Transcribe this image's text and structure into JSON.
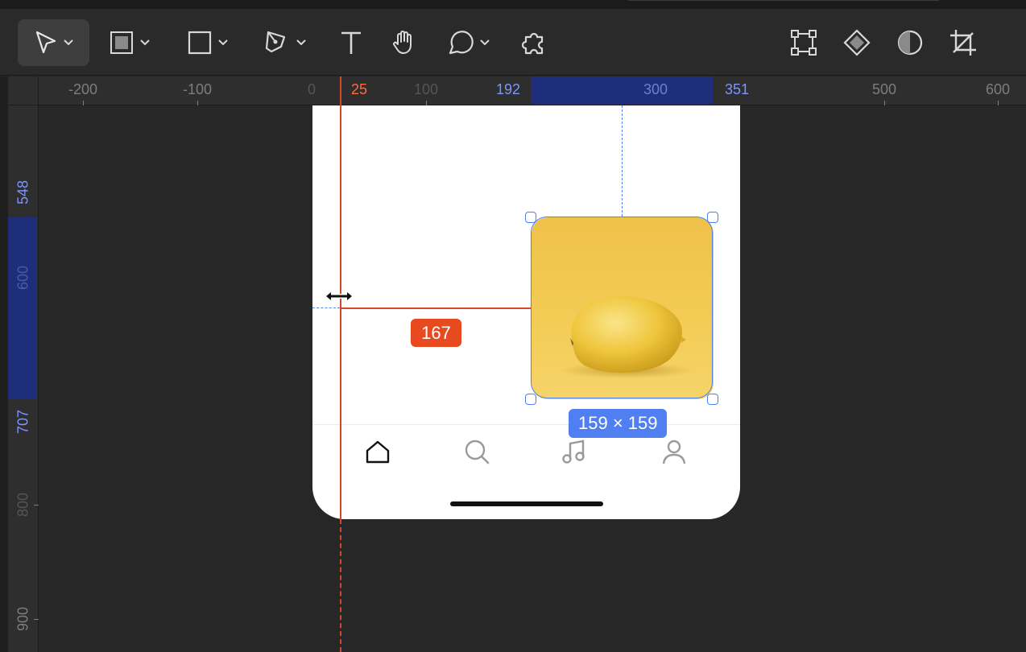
{
  "toolbar": {
    "tools": [
      {
        "name": "move-tool",
        "icon": "cursor-arrow-icon",
        "has_dropdown": true,
        "active": true
      },
      {
        "name": "frame-tool",
        "icon": "frame-icon",
        "has_dropdown": true
      },
      {
        "name": "rectangle-tool",
        "icon": "rectangle-icon",
        "has_dropdown": true
      },
      {
        "name": "pen-tool",
        "icon": "pen-icon",
        "has_dropdown": true
      },
      {
        "name": "text-tool",
        "icon": "text-icon"
      },
      {
        "name": "hand-tool",
        "icon": "hand-icon"
      },
      {
        "name": "comment-tool",
        "icon": "comment-icon",
        "has_dropdown": true
      },
      {
        "name": "plugins-tool",
        "icon": "plugin-icon"
      }
    ],
    "right_tools": [
      {
        "name": "transform-tool",
        "icon": "bounding-box-icon"
      },
      {
        "name": "component-tool",
        "icon": "diamond-icon"
      },
      {
        "name": "mask-tool",
        "icon": "half-circle-icon"
      },
      {
        "name": "crop-tool",
        "icon": "crop-icon"
      }
    ]
  },
  "horizontal_ruler": {
    "labels": [
      "-200",
      "-100",
      "0",
      "25",
      "100",
      "192",
      "300",
      "351",
      "500",
      "600"
    ]
  },
  "vertical_ruler": {
    "labels": [
      "548",
      "600",
      "707",
      "800",
      "900"
    ]
  },
  "canvas": {
    "distance_label": "167",
    "size_label": "159 × 159",
    "selected_image": "lemon-photo",
    "colors": {
      "selection": "#4f7ff0",
      "guide": "#d8462a",
      "ruler_highlight": "#1e2e7a",
      "canvas": "#272727"
    }
  },
  "tab_bar": {
    "icons": [
      "home-icon",
      "search-icon",
      "music-note-icon",
      "profile-icon"
    ]
  }
}
